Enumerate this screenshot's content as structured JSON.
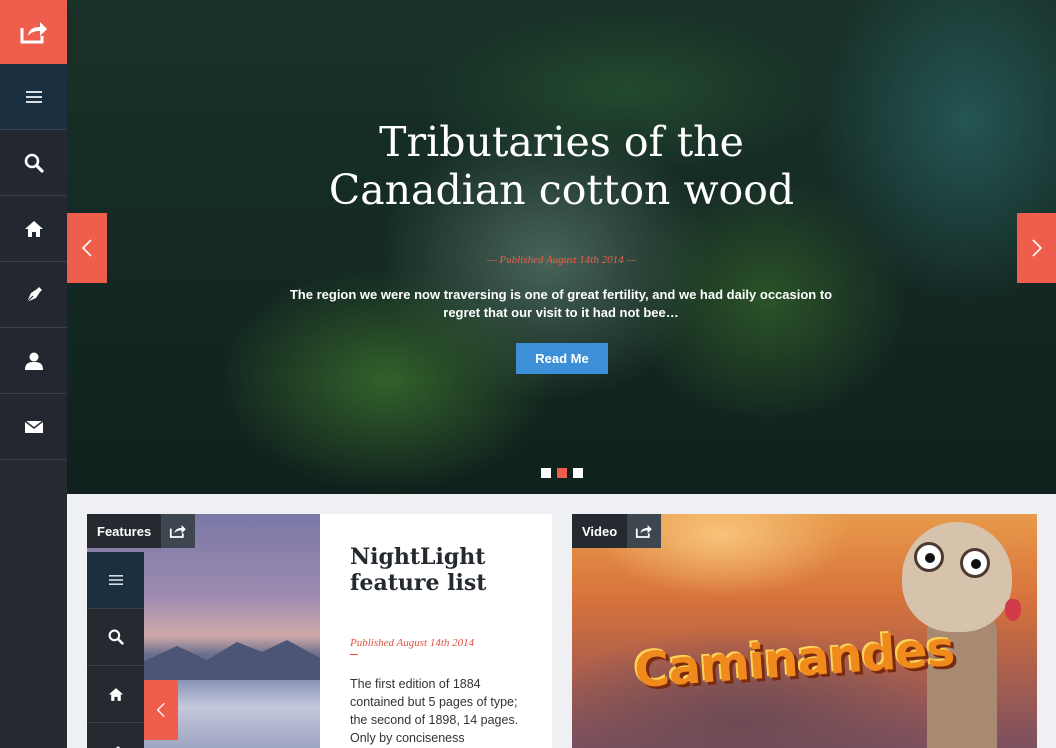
{
  "sidebar": {
    "items": [
      {
        "name": "menu"
      },
      {
        "name": "search"
      },
      {
        "name": "home"
      },
      {
        "name": "pen"
      },
      {
        "name": "user"
      },
      {
        "name": "mail"
      }
    ]
  },
  "hero": {
    "title_line1": "Tributaries of the",
    "title_line2": "Canadian cotton wood",
    "published": "—   Published August 14th 2014   —",
    "excerpt": "The region we were now traversing is one of great fertility, and we had daily occasion to regret that our visit to it had not bee…",
    "button_label": "Read Me",
    "active_slide": 2,
    "slide_count": 3
  },
  "card_features": {
    "tag": "Features",
    "title_line1": "NightLight",
    "title_line2": "feature list",
    "published": "Published August 14th 2014",
    "text": "The first edition of 1884 contained but 5 pages of type; the second of 1898, 14 pages. Only by conciseness"
  },
  "card_video": {
    "tag": "Video",
    "logo": "Caminandes"
  },
  "colors": {
    "accent": "#ef5e4c",
    "sidebar": "#252a31",
    "button": "#3d8fd8"
  }
}
